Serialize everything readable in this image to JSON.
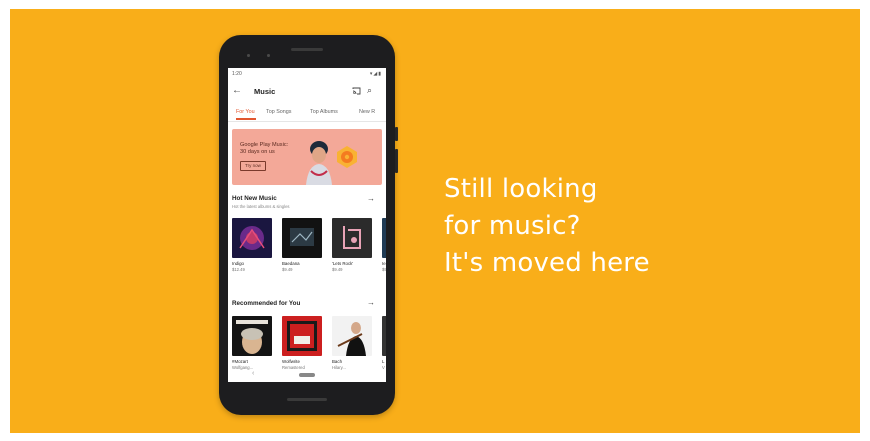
{
  "headline": {
    "line1": "Still looking",
    "line2": "for music?",
    "line3": "It's moved here"
  },
  "phone": {
    "status_time": "1:20",
    "status_icons": "▾◢▮",
    "appbar": {
      "title": "Music",
      "back_icon": "back-arrow-icon",
      "cast_icon": "cast-icon",
      "search_icon": "search-icon"
    },
    "tabs": [
      "For You",
      "Top Songs",
      "Top Albums",
      "New R"
    ],
    "banner": {
      "line1": "Google Play Music:",
      "line2": "30 days on us",
      "button": "Try now"
    },
    "hot_new_music": {
      "title": "Hot New Music",
      "subtitle": "Hot the latest albums & singles",
      "items": [
        {
          "name": "Indigo",
          "price": "$12.49"
        },
        {
          "name": "Baedana",
          "price": "$9.49"
        },
        {
          "name": "'Lets Rock'",
          "price": "$9.49"
        },
        {
          "name": "Ie",
          "price": "$9"
        }
      ]
    },
    "recommended": {
      "title": "Recommended for You",
      "items": [
        {
          "name": "#Mozart",
          "price": "Wolfgang..."
        },
        {
          "name": "Wolfwrite",
          "price": "Remastered"
        },
        {
          "name": "Bach",
          "price": "Hilary..."
        },
        {
          "name": "L",
          "price": "V"
        }
      ]
    },
    "colors": {
      "accent": "#e2562f",
      "banner": "#F3A898",
      "background": "#F9AE19"
    }
  }
}
